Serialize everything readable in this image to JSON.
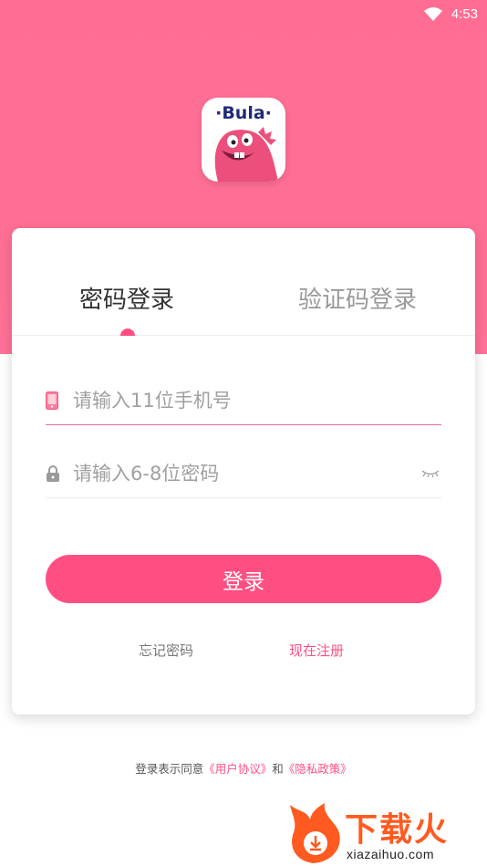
{
  "status_bar": {
    "time": "4:53"
  },
  "logo": {
    "text": "·Bula·"
  },
  "tabs": [
    {
      "label": "密码登录",
      "active": true
    },
    {
      "label": "验证码登录",
      "active": false
    }
  ],
  "form": {
    "phone_placeholder": "请输入11位手机号",
    "password_placeholder": "请输入6-8位密码",
    "login_label": "登录"
  },
  "links": {
    "forgot": "忘记密码",
    "register": "现在注册"
  },
  "agreement": {
    "prefix": "登录表示同意",
    "user_agreement": "《用户协议》",
    "conjunction": "和",
    "privacy_policy": "《隐私政策》"
  },
  "watermark": {
    "title": "下载火",
    "subtitle": "xiazaihuo.com"
  },
  "colors": {
    "primary": "#ff4f82",
    "hero": "#ff6d93",
    "watermark": "#ff5a1f"
  }
}
